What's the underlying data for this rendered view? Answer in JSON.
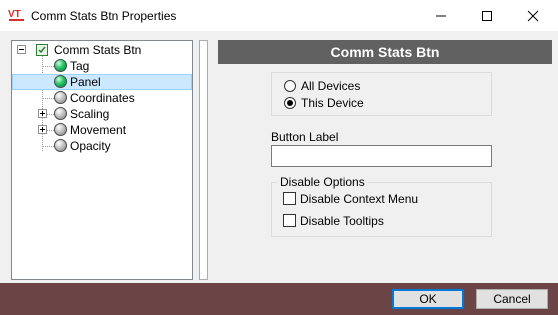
{
  "window": {
    "title": "Comm Stats Btn Properties",
    "logo_icon": "vtscada-logo-icon",
    "controls": [
      "minimize-icon",
      "maximize-icon",
      "close-icon"
    ]
  },
  "tree": {
    "root": {
      "label": "Comm Stats Btn",
      "expanded": true
    },
    "items": [
      {
        "label": "Tag",
        "status": "green",
        "expandable": false,
        "selected": false
      },
      {
        "label": "Panel",
        "status": "green",
        "expandable": false,
        "selected": true
      },
      {
        "label": "Coordinates",
        "status": "gray",
        "expandable": false,
        "selected": false
      },
      {
        "label": "Scaling",
        "status": "gray",
        "expandable": true,
        "selected": false
      },
      {
        "label": "Movement",
        "status": "gray",
        "expandable": true,
        "selected": false
      },
      {
        "label": "Opacity",
        "status": "gray",
        "expandable": false,
        "selected": false
      }
    ]
  },
  "panel": {
    "header": "Comm Stats Btn",
    "scope_options": [
      {
        "label": "All Devices",
        "checked": false
      },
      {
        "label": "This Device",
        "checked": true
      }
    ],
    "button_label": {
      "label": "Button Label",
      "value": ""
    },
    "disable_options": {
      "title": "Disable Options",
      "items": [
        {
          "label": "Disable Context Menu",
          "checked": false
        },
        {
          "label": "Disable Tooltips",
          "checked": false
        }
      ]
    }
  },
  "footer": {
    "ok_label": "OK",
    "cancel_label": "Cancel"
  },
  "colors": {
    "header_bg": "#616161",
    "selection_bg": "#cce8ff",
    "footer_bg": "#6b4545",
    "default_button_border": "#0078d7"
  }
}
